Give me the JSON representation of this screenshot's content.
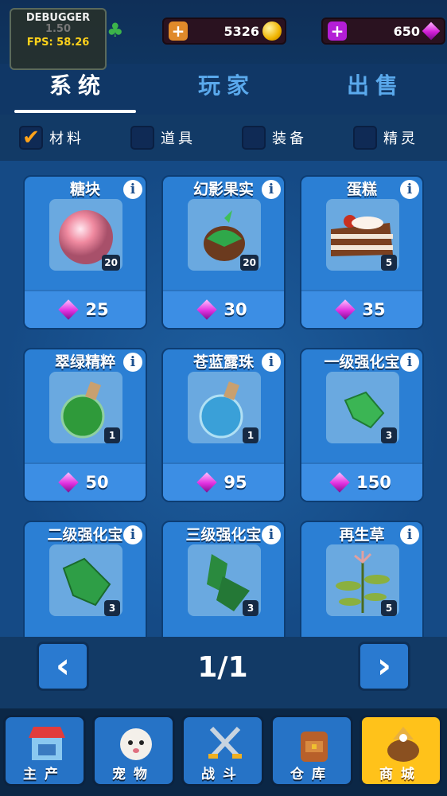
{
  "debugger": {
    "title": "DEBUGGER",
    "value": "1.50",
    "fps": "FPS: 58.26"
  },
  "currency": {
    "coins": "5326",
    "gems": "650"
  },
  "tabs": [
    {
      "label": "系统",
      "active": true
    },
    {
      "label": "玩家",
      "active": false
    },
    {
      "label": "出售",
      "active": false
    }
  ],
  "filters": [
    {
      "label": "材料",
      "checked": true
    },
    {
      "label": "道具",
      "checked": false
    },
    {
      "label": "装备",
      "checked": false
    },
    {
      "label": "精灵",
      "checked": false
    }
  ],
  "items": [
    {
      "name": "糖块",
      "count": "20",
      "price": "25",
      "icon": "pink-orb-icon"
    },
    {
      "name": "幻影果实",
      "count": "20",
      "price": "30",
      "icon": "green-fruit-icon"
    },
    {
      "name": "蛋糕",
      "count": "5",
      "price": "35",
      "icon": "cake-slice-icon"
    },
    {
      "name": "翠绿精粹",
      "count": "1",
      "price": "50",
      "icon": "green-potion-icon"
    },
    {
      "name": "苍蓝露珠",
      "count": "1",
      "price": "95",
      "icon": "blue-potion-icon"
    },
    {
      "name": "一级强化宝",
      "count": "3",
      "price": "150",
      "icon": "green-crystal-small-icon"
    },
    {
      "name": "二级强化宝",
      "count": "3",
      "price": "",
      "icon": "green-crystal-medium-icon"
    },
    {
      "name": "三级强化宝",
      "count": "3",
      "price": "",
      "icon": "green-crystal-large-icon"
    },
    {
      "name": "再生草",
      "count": "5",
      "price": "",
      "icon": "herb-plant-icon"
    }
  ],
  "pager": {
    "text": "1/1"
  },
  "nav": [
    {
      "label": "主产",
      "icon": "shop-stall-icon",
      "active": false
    },
    {
      "label": "宠物",
      "icon": "pet-face-icon",
      "active": false
    },
    {
      "label": "战斗",
      "icon": "crossed-swords-icon",
      "active": false
    },
    {
      "label": "仓库",
      "icon": "backpack-icon",
      "active": false
    },
    {
      "label": "商城",
      "icon": "treasure-bag-icon",
      "active": true
    }
  ]
}
